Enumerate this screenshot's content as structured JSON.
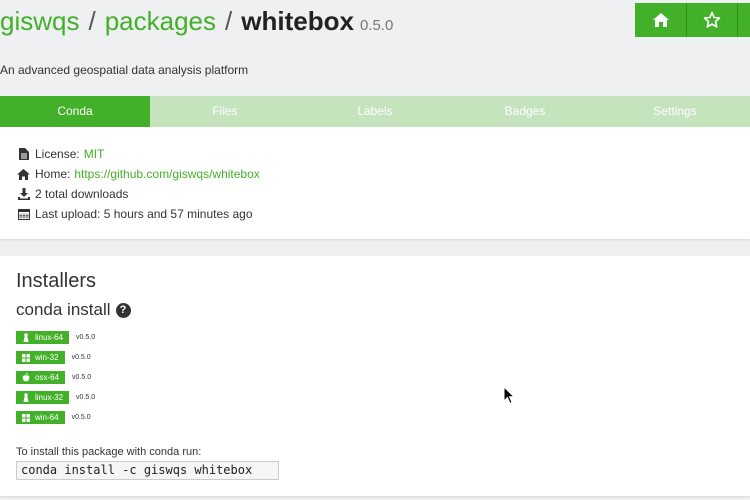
{
  "breadcrumb": {
    "owner": "giswqs",
    "sep1": "/",
    "section": "packages",
    "sep2": "/",
    "package": "whitebox",
    "version": "0.5.0"
  },
  "summary": "An advanced geospatial data analysis platform",
  "actions": {
    "home_icon": "home-icon",
    "star_icon": "star-icon"
  },
  "tabs": [
    {
      "label": "Conda",
      "active": true
    },
    {
      "label": "Files",
      "active": false
    },
    {
      "label": "Labels",
      "active": false
    },
    {
      "label": "Badges",
      "active": false
    },
    {
      "label": "Settings",
      "active": false
    }
  ],
  "info": {
    "license_label": "License:",
    "license_value": "MIT",
    "home_label": "Home:",
    "home_value": "https://github.com/giswqs/whitebox",
    "downloads": "2 total downloads",
    "last_upload": "Last upload: 5 hours and 57 minutes ago"
  },
  "installers": {
    "title": "Installers",
    "subtitle": "conda install",
    "platforms": [
      {
        "name": "linux-64",
        "icon": "linux-icon",
        "version": "v0.5.0"
      },
      {
        "name": "win-32",
        "icon": "windows-icon",
        "version": "v0.5.0"
      },
      {
        "name": "osx-64",
        "icon": "apple-icon",
        "version": "v0.5.0"
      },
      {
        "name": "linux-32",
        "icon": "linux-icon",
        "version": "v0.5.0"
      },
      {
        "name": "win-64",
        "icon": "windows-icon",
        "version": "v0.5.0"
      }
    ],
    "run_label": "To install this package with conda run:",
    "command": "conda install -c giswqs whitebox"
  },
  "colors": {
    "accent": "#43b02a",
    "tab_inactive": "#c5e4bd",
    "background": "#eef0f2"
  }
}
